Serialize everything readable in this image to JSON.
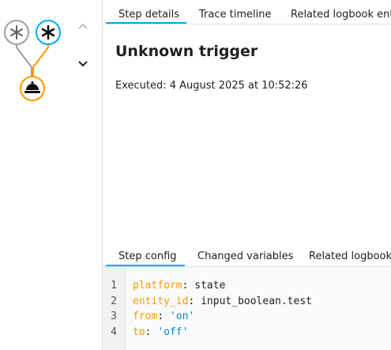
{
  "colors": {
    "accent": "#03a9f4",
    "trace_active": "#ff9800",
    "inactive": "#9e9e9e",
    "yaml_key": "#ff9800",
    "yaml_string": "#0288d1"
  },
  "graph": {
    "nodes": [
      {
        "icon": "asterisk-icon",
        "state": "inactive"
      },
      {
        "icon": "asterisk-icon",
        "state": "selected"
      },
      {
        "icon": "bell-icon",
        "state": "active"
      }
    ]
  },
  "nav": {
    "up_icon": "chevron-up-icon",
    "down_icon": "chevron-down-icon"
  },
  "tabs": {
    "step_details": "Step details",
    "trace_timeline": "Trace timeline",
    "related_logbook": "Related logbook entries"
  },
  "details": {
    "title": "Unknown trigger",
    "executed": "Executed: 4 August 2025 at 10:52:26"
  },
  "subtabs": {
    "step_config": "Step config",
    "changed_variables": "Changed variables",
    "related_logbook": "Related logbook entries"
  },
  "code": {
    "line_numbers": [
      "1",
      "2",
      "3",
      "4"
    ],
    "lines": [
      {
        "key": "platform",
        "sep": ": ",
        "value": "state",
        "value_type": "plain"
      },
      {
        "key": "entity_id",
        "sep": ": ",
        "value": "input_boolean.test",
        "value_type": "plain"
      },
      {
        "key": "from",
        "sep": ": ",
        "value": "'on'",
        "value_type": "string"
      },
      {
        "key": "to",
        "sep": ": ",
        "value": "'off'",
        "value_type": "string"
      }
    ]
  }
}
